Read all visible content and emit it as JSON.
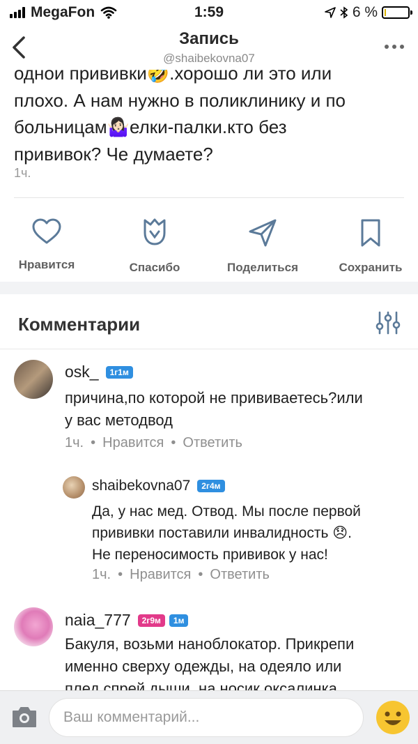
{
  "status_bar": {
    "carrier": "MegaFon",
    "time": "1:59",
    "battery": "6 %",
    "battery_level": 0.06
  },
  "nav": {
    "title": "Запись",
    "subtitle": "@shaibekovna07"
  },
  "post": {
    "lines": [
      "одной прививки🤣.хорошо ли это или",
      "плохо. А нам нужно в поликлинику и по",
      "больницам🤷🏻‍♀️елки-палки.кто без",
      "прививок? Че думаете?"
    ],
    "time": "1ч."
  },
  "actions": {
    "like": "Нравится",
    "thanks": "Спасибо",
    "share": "Поделиться",
    "save": "Сохранить"
  },
  "comments_section": {
    "title": "Комментарии"
  },
  "comments": [
    {
      "author": "osk_",
      "badges": [
        "1г1м"
      ],
      "text_lines": [
        "причина,по которой не прививаетесь?или",
        "у вас методвод"
      ],
      "time": "1ч.",
      "like": "Нравится",
      "reply": "Ответить"
    },
    {
      "author": "shaibekovna07",
      "badges": [
        "2г4м"
      ],
      "text_lines": [
        "Да, у нас мед. Отвод. Мы после первой",
        "прививки поставили инвалидность 😞.",
        "Не переносимость прививок у нас!"
      ],
      "time": "1ч.",
      "like": "Нравится",
      "reply": "Ответить"
    },
    {
      "author": "naia_777",
      "badges": [
        "2г9м",
        "1м"
      ],
      "text_lines": [
        "Бакуля, возьми наноблокатор. Прикрепи",
        "именно сверху одежды, на одеяло или",
        "плед спрей дыши, на носик оксалинка"
      ]
    }
  ],
  "input": {
    "placeholder": "Ваш комментарий..."
  },
  "colors": {
    "badge_blue": "#2f8fe0",
    "badge_pink": "#e23a8a",
    "battery_fill": "#d8b000",
    "emoji_yellow": "#f7c531"
  },
  "icons": [
    "signal-icon",
    "wifi-icon",
    "location-icon",
    "bluetooth-icon",
    "battery-icon",
    "back-chevron-icon",
    "more-icon",
    "heart-icon",
    "tulip-icon",
    "paper-plane-icon",
    "bookmark-icon",
    "filter-icon",
    "camera-icon",
    "smile-emoji-icon"
  ]
}
